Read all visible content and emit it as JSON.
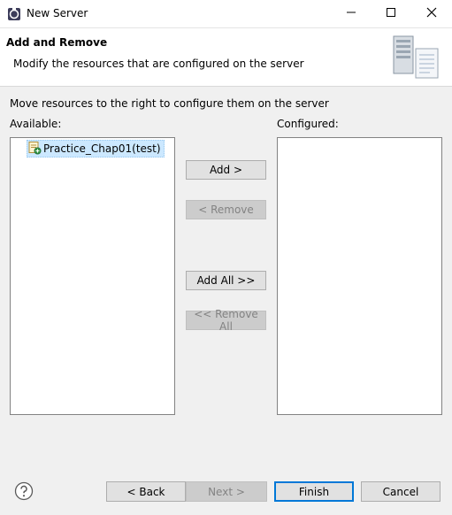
{
  "window": {
    "title": "New Server"
  },
  "banner": {
    "title": "Add and Remove",
    "description": "Modify the resources that are configured on the server"
  },
  "instructions": "Move resources to the right to configure them on the server",
  "available": {
    "label": "Available:",
    "items": [
      {
        "label": "Practice_Chap01",
        "suffix": "(test)",
        "selected": true
      }
    ]
  },
  "configured": {
    "label": "Configured:",
    "items": []
  },
  "buttons": {
    "add": "Add >",
    "remove": "< Remove",
    "add_all": "Add All >>",
    "remove_all": "<< Remove All",
    "back": "< Back",
    "next": "Next >",
    "finish": "Finish",
    "cancel": "Cancel"
  },
  "icons": {
    "app": "eclipse-server-icon",
    "banner": "server-wizard-icon",
    "project": "web-project-icon",
    "help": "help-icon"
  },
  "colors": {
    "selection": "#cce8ff",
    "default_button_border": "#0078d7"
  }
}
